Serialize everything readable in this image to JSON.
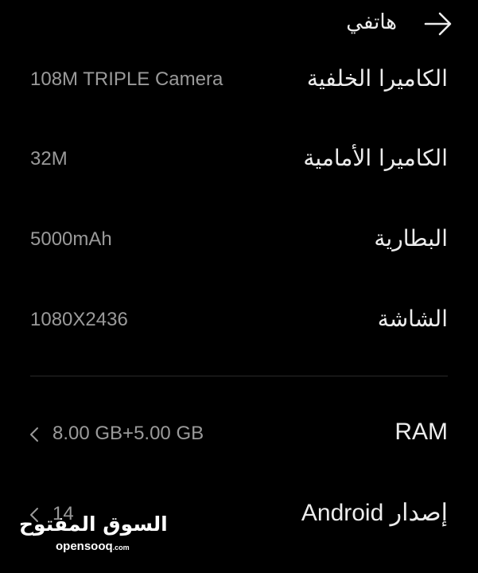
{
  "header": {
    "title": "هاتفي",
    "back_icon": "arrow-right-icon"
  },
  "rows": [
    {
      "label": "الكاميرا الخلفية",
      "value": "108M TRIPLE Camera"
    },
    {
      "label": "الكاميرا الأمامية",
      "value": "32M"
    },
    {
      "label": "البطارية",
      "value": "5000mAh"
    },
    {
      "label": "الشاشة",
      "value": "1080X2436"
    },
    {
      "label": "RAM",
      "value": "8.00 GB+5.00 GB",
      "chevron": "chevron-left-icon"
    },
    {
      "label": "إصدار Android",
      "value": "14",
      "chevron": "chevron-left-icon"
    }
  ],
  "watermark": {
    "arabic": "السوق المفتوح",
    "latin": "opensooq",
    "suffix": ".com"
  },
  "colors": {
    "background": "#000000",
    "label": "#ececec",
    "value": "#9a9a9a",
    "divider": "#2a2a2a"
  }
}
